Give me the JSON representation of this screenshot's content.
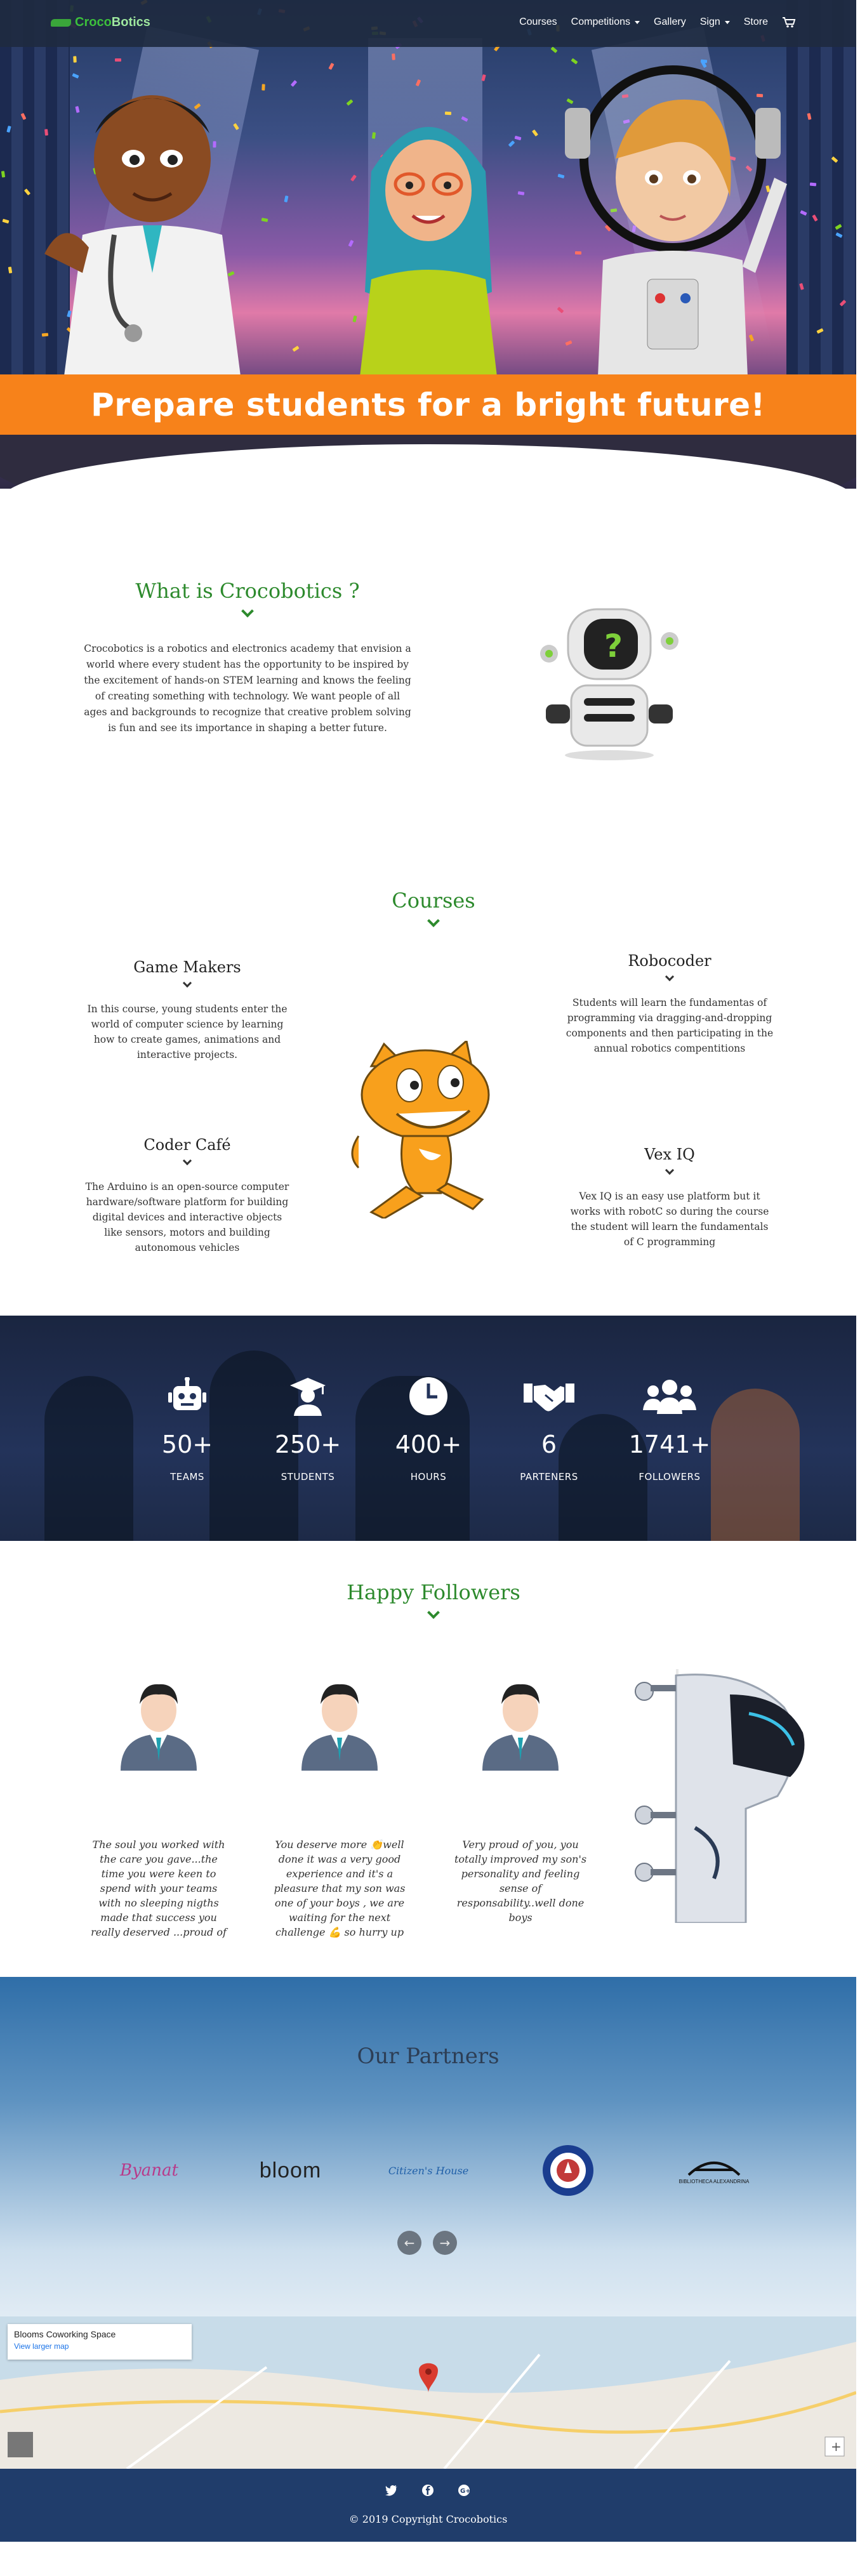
{
  "nav": {
    "logo_part1": "Croco",
    "logo_part2": "Botics",
    "items": [
      {
        "label": "Courses"
      },
      {
        "label": "Competitions"
      },
      {
        "label": "Gallery"
      },
      {
        "label": "Sign"
      },
      {
        "label": "Store"
      }
    ]
  },
  "hero": {
    "banner": "Prepare students for a bright future!"
  },
  "about": {
    "title": "What is Crocobotics ?",
    "text": "Crocobotics is a robotics and electronics academy that envision a world where every student has the opportunity to be inspired by the excitement of hands-on STEM learning and knows the feeling of creating something with technology. We want people of all ages and backgrounds to recognize that creative problem solving is fun and see its importance in shaping a better future."
  },
  "courses": {
    "title": "Courses",
    "items": [
      {
        "name": "Game Makers",
        "text": "In this course, young students enter the world of computer science by learning how to create games, animations and interactive projects."
      },
      {
        "name": "Robocoder",
        "text": "Students will learn the fundamentas of programming via dragging-and-dropping components and then participating in the annual robotics compentitions"
      },
      {
        "name": "Coder Café",
        "text": "The Arduino is an open-source computer hardware/software platform for building digital devices and interactive objects like sensors, motors and building autonomous vehicles"
      },
      {
        "name": "Vex IQ",
        "text": "Vex IQ is an easy use platform but it works with robotC so during the course the student will learn the fundamentals of C programming"
      }
    ]
  },
  "stats": [
    {
      "icon": "robot-icon",
      "value": "50+",
      "label": "TEAMS"
    },
    {
      "icon": "graduate-icon",
      "value": "250+",
      "label": "STUDENTS"
    },
    {
      "icon": "clock-icon",
      "value": "400+",
      "label": "HOURS"
    },
    {
      "icon": "handshake-icon",
      "value": "6",
      "label": "PARTENERS"
    },
    {
      "icon": "users-icon",
      "value": "1741+",
      "label": "FOLLOWERS"
    }
  ],
  "followers": {
    "title": "Happy Followers",
    "testimonials": [
      {
        "text": "The soul you worked with the care you gave...the time you were keen to spend with your teams with no sleeping nigths made that success you really deserved ...proud of you"
      },
      {
        "text": "You deserve more 👏well done it was a very good experience and it's a pleasure that my son was one of your boys , we are waiting for the next challenge 💪 so hurry up"
      },
      {
        "text": "Very proud of you, you totally improved my son's personality and feeling sense of responsability..well done boys"
      }
    ]
  },
  "partners": {
    "title": "Our Partners",
    "logos": [
      {
        "text": "Byanat",
        "color": "#b83a8a"
      },
      {
        "text": "bloom",
        "color": "#222222"
      },
      {
        "text": "Citizen's House",
        "color": "#1f5fa8"
      },
      {
        "text": "",
        "color": "#1a3d8f"
      },
      {
        "text": "BIBLIOTHECA ALEXANDRINA",
        "color": "#111111"
      }
    ]
  },
  "map": {
    "place": "Blooms Coworking Space",
    "link": "View larger map"
  },
  "footer": {
    "copyright": "© 2019 Copyright Crocobotics"
  }
}
